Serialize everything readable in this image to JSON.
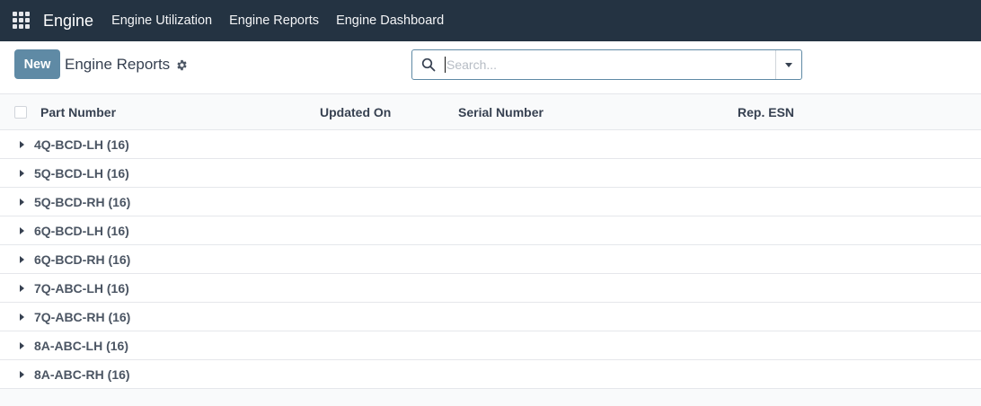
{
  "navbar": {
    "brand": "Engine",
    "items": [
      {
        "label": "Engine Utilization"
      },
      {
        "label": "Engine Reports"
      },
      {
        "label": "Engine Dashboard"
      }
    ]
  },
  "control_panel": {
    "new_label": "New",
    "breadcrumb": "Engine Reports",
    "search": {
      "placeholder": "Search...",
      "value": ""
    }
  },
  "list": {
    "columns": [
      "Part Number",
      "Updated On",
      "Serial Number",
      "Rep. ESN"
    ],
    "groups": [
      {
        "label": "4Q-BCD-LH (16)"
      },
      {
        "label": "5Q-BCD-LH (16)"
      },
      {
        "label": "5Q-BCD-RH (16)"
      },
      {
        "label": "6Q-BCD-LH (16)"
      },
      {
        "label": "6Q-BCD-RH (16)"
      },
      {
        "label": "7Q-ABC-LH (16)"
      },
      {
        "label": "7Q-ABC-RH (16)"
      },
      {
        "label": "8A-ABC-LH (16)"
      },
      {
        "label": "8A-ABC-RH (16)"
      }
    ]
  },
  "colors": {
    "navbar_bg": "#243342",
    "primary": "#5f8aa5"
  },
  "icons": {
    "apps": "apps-grid-icon",
    "settings": "gear-icon",
    "search": "search-icon",
    "dropdown": "caret-down-icon",
    "expand": "caret-right-icon"
  }
}
